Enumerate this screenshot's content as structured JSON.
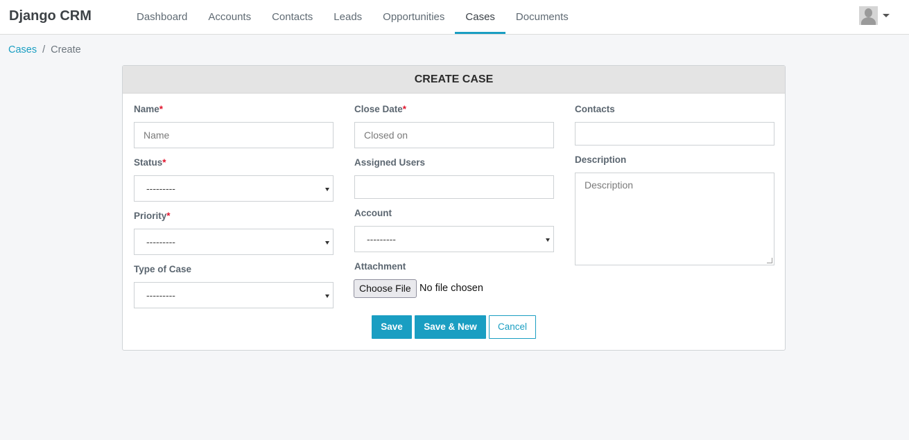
{
  "app": {
    "brand": "Django CRM"
  },
  "nav": {
    "items": [
      {
        "label": "Dashboard"
      },
      {
        "label": "Accounts"
      },
      {
        "label": "Contacts"
      },
      {
        "label": "Leads"
      },
      {
        "label": "Opportunities"
      },
      {
        "label": "Cases",
        "active": true
      },
      {
        "label": "Documents"
      }
    ]
  },
  "user": {
    "avatar_icon": "user-avatar-icon",
    "menu_icon": "caret-down-icon"
  },
  "breadcrumb": {
    "parent": "Cases",
    "separator": "/",
    "current": "Create"
  },
  "form": {
    "title": "CREATE CASE",
    "required_mark": "*",
    "name": {
      "label": "Name",
      "placeholder": "Name",
      "value": ""
    },
    "status": {
      "label": "Status",
      "selected": "---------"
    },
    "priority": {
      "label": "Priority",
      "selected": "---------"
    },
    "case_type": {
      "label": "Type of Case",
      "selected": "---------"
    },
    "close_date": {
      "label": "Close Date",
      "placeholder": "Closed on",
      "value": ""
    },
    "assigned_users": {
      "label": "Assigned Users",
      "value": ""
    },
    "account": {
      "label": "Account",
      "selected": "---------"
    },
    "attachment": {
      "label": "Attachment",
      "button": "Choose File",
      "status": "No file chosen"
    },
    "contacts": {
      "label": "Contacts",
      "value": ""
    },
    "description": {
      "label": "Description",
      "placeholder": "Description",
      "value": ""
    }
  },
  "actions": {
    "save": "Save",
    "save_new": "Save & New",
    "cancel": "Cancel"
  },
  "colors": {
    "accent": "#1a9ec2",
    "required": "#e0152d",
    "header_bg": "#e4e4e4",
    "page_bg": "#f5f6f8"
  }
}
